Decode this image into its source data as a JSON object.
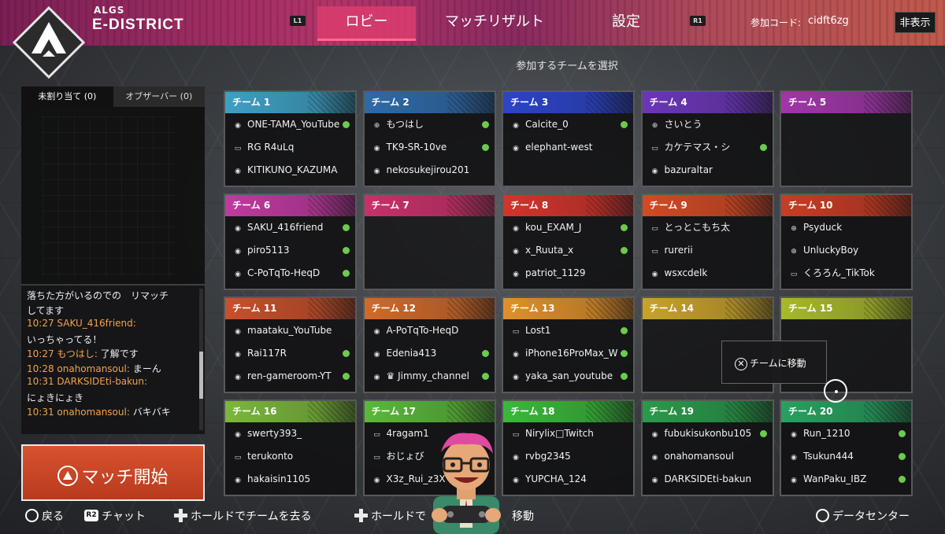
{
  "brand": {
    "small": "ALGS",
    "big": "E-DISTRICT"
  },
  "nav": {
    "l1": "L1",
    "r1": "R1",
    "tabs": [
      {
        "label": "ロビー",
        "active": true
      },
      {
        "label": "マッチリザルト",
        "active": false
      },
      {
        "label": "設定",
        "active": false
      }
    ]
  },
  "join": {
    "label": "参加コード:",
    "code": "cidft6zg"
  },
  "hide_label": "非表示",
  "select_title": "参加するチームを選択",
  "left_tabs": {
    "unassigned": "未割り当て (0)",
    "observer": "オブザーバー (0)"
  },
  "chat": [
    {
      "who": "",
      "text": "落ちた方がいるのでの　リマッチ"
    },
    {
      "who": "",
      "text": "してます"
    },
    {
      "who": "10:27 SAKU_416friend:",
      "text": ""
    },
    {
      "who": "",
      "text": "いっちゃってる！"
    },
    {
      "who": "10:27 もつはし:",
      "text": " 了解です"
    },
    {
      "who": "10:28 onahomansoul:",
      "text": " まーん"
    },
    {
      "who": "10:31 DARKSIDEti-bakun:",
      "text": ""
    },
    {
      "who": "",
      "text": "にょきにょき"
    },
    {
      "who": "10:31 onahomansoul:",
      "text": " バキバキ"
    }
  ],
  "start_label": "マッチ開始",
  "teams": [
    {
      "name": "チーム 1",
      "color": "#3ea0c4",
      "players": [
        [
          "a",
          "ONE-TAMA_YouTube",
          true
        ],
        [
          "pc",
          "RG R4uLq",
          false
        ],
        [
          "a",
          "KITIKUNO_KAZUMA",
          false
        ]
      ]
    },
    {
      "name": "チーム 2",
      "color": "#2f6aa8",
      "players": [
        [
          "c",
          "もつはし",
          true
        ],
        [
          "a",
          "TK9-SR-10ve",
          true
        ],
        [
          "a",
          "nekosukejirou201",
          false
        ]
      ]
    },
    {
      "name": "チーム 3",
      "color": "#2c44c8",
      "players": [
        [
          "a",
          "Calcite_0",
          true
        ],
        [
          "a",
          "elephant-west",
          false
        ]
      ]
    },
    {
      "name": "チーム 4",
      "color": "#6b36b8",
      "players": [
        [
          "c",
          "さいとう",
          false
        ],
        [
          "pc",
          "カケテマス・シ",
          true
        ],
        [
          "a",
          "bazuraltar",
          false
        ]
      ]
    },
    {
      "name": "チーム 5",
      "color": "#a036a8",
      "players": []
    },
    {
      "name": "チーム 6",
      "color": "#c03aa0",
      "players": [
        [
          "a",
          "SAKU_416friend",
          true
        ],
        [
          "a",
          "piro5113",
          true
        ],
        [
          "a",
          "C-PoTqTo-HeqD",
          true
        ]
      ]
    },
    {
      "name": "チーム 7",
      "color": "#c8306a",
      "players": []
    },
    {
      "name": "チーム 8",
      "color": "#d2342c",
      "players": [
        [
          "a",
          "kou_EXAM_J",
          true
        ],
        [
          "a",
          "x_Ruuta_x",
          true
        ],
        [
          "a",
          "patriot_1129",
          false
        ]
      ]
    },
    {
      "name": "チーム 9",
      "color": "#d24a24",
      "players": [
        [
          "pc",
          "とっとこもち太",
          false
        ],
        [
          "pc",
          "rurerii",
          false
        ],
        [
          "a",
          "wsxcdelk",
          false
        ]
      ]
    },
    {
      "name": "チーム 10",
      "color": "#c83c24",
      "players": [
        [
          "c",
          "Psyduck",
          false
        ],
        [
          "c",
          "UnluckyBoy",
          false
        ],
        [
          "pc",
          "くろろん_TikTok",
          false
        ]
      ]
    },
    {
      "name": "チーム 11",
      "color": "#c8502a",
      "players": [
        [
          "a",
          "maataku_YouTube",
          false
        ],
        [
          "a",
          "Rai117R",
          true
        ],
        [
          "a",
          "ren-gameroom-YT",
          true
        ]
      ]
    },
    {
      "name": "チーム 12",
      "color": "#d06a2a",
      "players": [
        [
          "a",
          "A-PoTqTo-HeqD",
          false
        ],
        [
          "a",
          "Edenia413",
          true
        ],
        [
          "a",
          "♛ Jimmy_channel",
          true
        ]
      ]
    },
    {
      "name": "チーム 13",
      "color": "#e0902a",
      "players": [
        [
          "pc",
          "Lost1",
          true
        ],
        [
          "a",
          "iPhone16ProMax_W",
          true
        ],
        [
          "a",
          "yaka_san_youtube",
          true
        ]
      ]
    },
    {
      "name": "チーム 14",
      "color": "#c8a22a",
      "players": []
    },
    {
      "name": "チーム 15",
      "color": "#a8b82a",
      "players": []
    },
    {
      "name": "チーム 16",
      "color": "#7ab83a",
      "players": [
        [
          "a",
          "swerty393_",
          false
        ],
        [
          "pc",
          "terukonto",
          false
        ],
        [
          "a",
          "hakaisin1105",
          false
        ]
      ]
    },
    {
      "name": "チーム 17",
      "color": "#5ab83a",
      "players": [
        [
          "pc",
          "4ragam1",
          false
        ],
        [
          "pc",
          "おじょび",
          false
        ],
        [
          "a",
          "X3z_Rui_z3X",
          false
        ]
      ]
    },
    {
      "name": "チーム 18",
      "color": "#3ab83a",
      "players": [
        [
          "pc",
          "Nirylix□Twitch",
          false
        ],
        [
          "a",
          "rvbg2345",
          false
        ],
        [
          "a",
          "YUPCHA_124",
          false
        ]
      ]
    },
    {
      "name": "チーム 19",
      "color": "#2a9a4a",
      "players": [
        [
          "a",
          "fubukisukonbu105",
          true
        ],
        [
          "a",
          "onahomansoul",
          false
        ],
        [
          "a",
          "DARKSIDEti-bakun",
          false
        ]
      ]
    },
    {
      "name": "チーム 20",
      "color": "#28a060",
      "players": [
        [
          "a",
          "Run_1210",
          true
        ],
        [
          "a",
          "Tsukun444",
          true
        ],
        [
          "a",
          "WanPaku_IBZ",
          true
        ]
      ]
    }
  ],
  "context_menu": {
    "label": "チームに移動"
  },
  "footer": {
    "back": "戻る",
    "chat": "チャット",
    "leave": "ホールドでチームを去る",
    "hold": "ホールドで",
    "move": "移動",
    "datacenter": "データセンター",
    "r2": "R2"
  },
  "colors": {
    "accent": "#dc3c6e",
    "online": "#6ccb4c",
    "start": "#c8431e"
  }
}
